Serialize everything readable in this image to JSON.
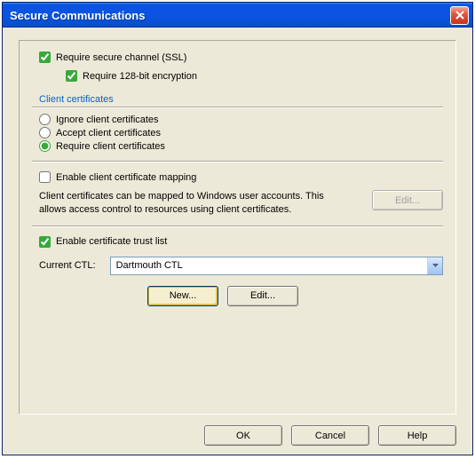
{
  "window": {
    "title": "Secure Communications"
  },
  "ssl": {
    "require_secure_channel": "Require secure channel (SSL)",
    "require_128bit": "Require 128-bit encryption"
  },
  "client_certs": {
    "group_label": "Client certificates",
    "ignore": "Ignore client certificates",
    "accept": "Accept client certificates",
    "require": "Require client certificates"
  },
  "mapping": {
    "enable": "Enable client certificate mapping",
    "description": "Client certificates can be mapped to Windows user accounts.  This allows access control to resources using client certificates.",
    "edit_btn": "Edit..."
  },
  "ctl": {
    "enable": "Enable certificate trust list",
    "current_label": "Current CTL:",
    "current_value": "Dartmouth CTL",
    "new_btn": "New...",
    "edit_btn": "Edit..."
  },
  "buttons": {
    "ok": "OK",
    "cancel": "Cancel",
    "help": "Help"
  }
}
